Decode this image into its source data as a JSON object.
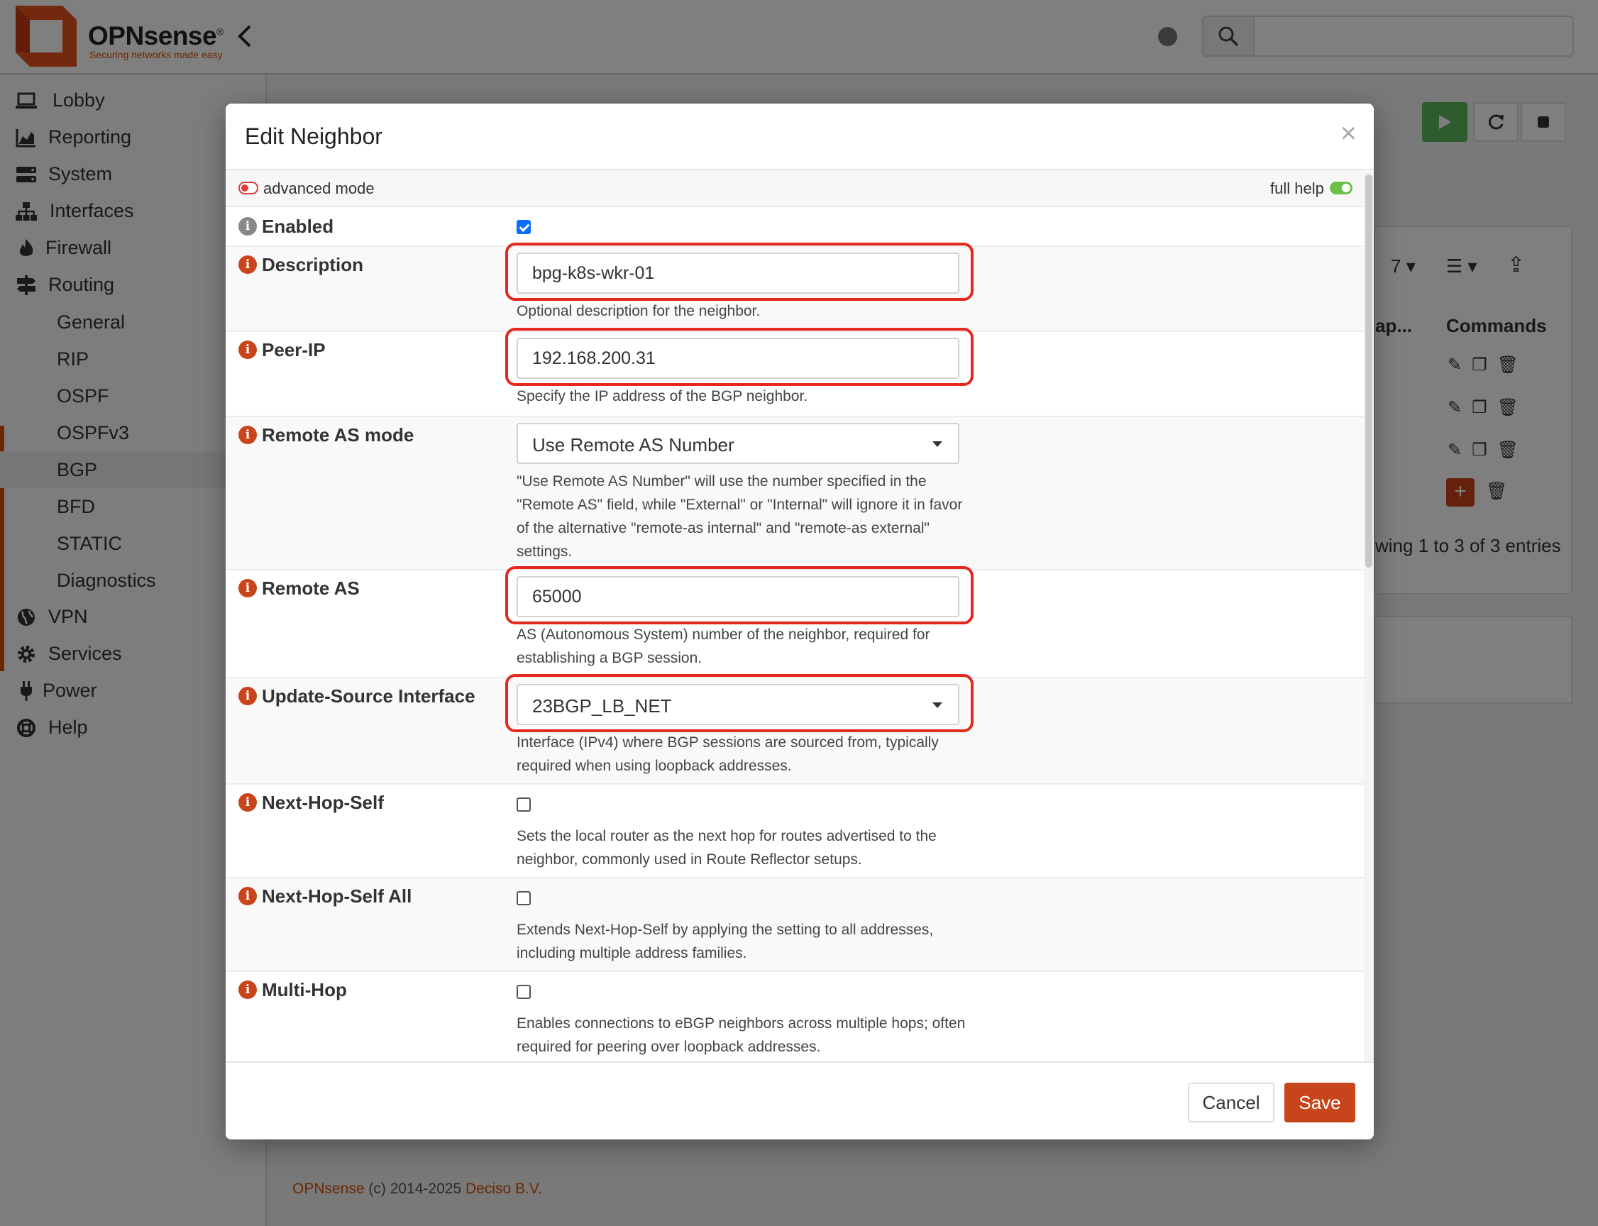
{
  "app": {
    "brand": "OPNsense",
    "brand_mark": "®",
    "tagline": "Securing networks made easy",
    "search_placeholder": ""
  },
  "sidebar": {
    "items": [
      {
        "label": "Lobby",
        "icon": "laptop-icon"
      },
      {
        "label": "Reporting",
        "icon": "chart-icon"
      },
      {
        "label": "System",
        "icon": "server-icon"
      },
      {
        "label": "Interfaces",
        "icon": "sitemap-icon"
      },
      {
        "label": "Firewall",
        "icon": "fire-icon"
      },
      {
        "label": "Routing",
        "icon": "signs-icon"
      },
      {
        "label": "VPN",
        "icon": "globe-icon"
      },
      {
        "label": "Services",
        "icon": "gear-icon"
      },
      {
        "label": "Power",
        "icon": "plug-icon"
      },
      {
        "label": "Help",
        "icon": "lifebuoy-icon"
      }
    ],
    "routing_sub": [
      "General",
      "RIP",
      "OSPF",
      "OSPFv3",
      "BGP",
      "BFD",
      "STATIC",
      "Diagnostics"
    ],
    "active_sub": "BGP"
  },
  "background": {
    "page_size": "7",
    "col_truncated": "ap...",
    "col_commands": "Commands",
    "showing": "wing 1 to 3 of 3 entries"
  },
  "modal": {
    "title": "Edit Neighbor",
    "close": "×",
    "advanced_mode": "advanced mode",
    "full_help": "full help",
    "fields": {
      "enabled": {
        "label": "Enabled",
        "checked": true
      },
      "description": {
        "label": "Description",
        "value": "bpg-k8s-wkr-01",
        "help": "Optional description for the neighbor."
      },
      "peer_ip": {
        "label": "Peer-IP",
        "value": "192.168.200.31",
        "help": "Specify the IP address of the BGP neighbor."
      },
      "remote_as_mode": {
        "label": "Remote AS mode",
        "value": "Use Remote AS Number",
        "help": "\"Use Remote AS Number\" will use the number specified in the \"Remote AS\" field, while \"External\" or \"Internal\" will ignore it in favor of the alternative \"remote-as internal\" and \"remote-as external\" settings."
      },
      "remote_as": {
        "label": "Remote AS",
        "value": "65000",
        "help": "AS (Autonomous System) number of the neighbor, required for establishing a BGP session."
      },
      "update_source": {
        "label": "Update-Source Interface",
        "value": "23BGP_LB_NET",
        "help": "Interface (IPv4) where BGP sessions are sourced from, typically required when using loopback addresses."
      },
      "next_hop_self": {
        "label": "Next-Hop-Self",
        "checked": false,
        "help": "Sets the local router as the next hop for routes advertised to the neighbor, commonly used in Route Reflector setups."
      },
      "next_hop_self_all": {
        "label": "Next-Hop-Self All",
        "checked": false,
        "help": "Extends Next-Hop-Self by applying the setting to all addresses, including multiple address families."
      },
      "multi_hop": {
        "label": "Multi-Hop",
        "checked": false,
        "help": "Enables connections to eBGP neighbors across multiple hops; often required for peering over loopback addresses."
      }
    },
    "cancel": "Cancel",
    "save": "Save"
  },
  "footer": {
    "brand": "OPNsense",
    "copyright": " (c) 2014-2025 ",
    "company": "Deciso B.V."
  },
  "colors": {
    "accent": "#d94f00",
    "save": "#c8441a",
    "highlight": "#e5281e",
    "toggle_on": "#6cc04a",
    "play": "#5cb85c"
  }
}
